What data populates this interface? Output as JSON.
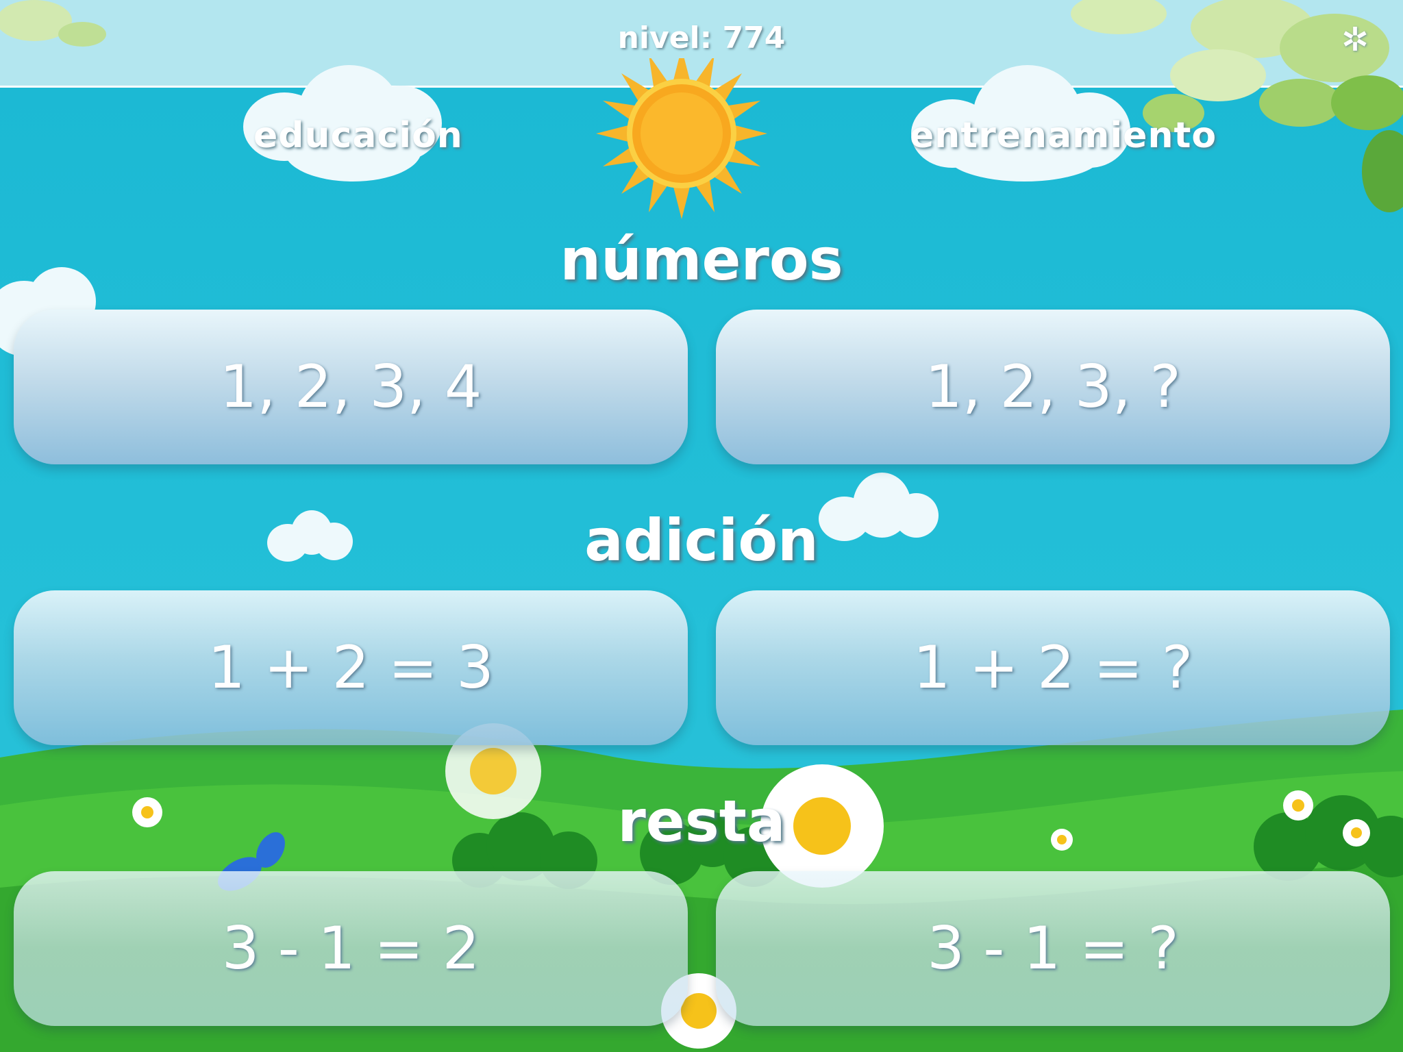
{
  "header": {
    "level_text": "nivel: 774",
    "settings_icon": "settings-icon"
  },
  "tabs": {
    "education": "educación",
    "training": "entrenamiento"
  },
  "sections": {
    "numbers": {
      "title": "números",
      "left_button": "1, 2, 3, 4",
      "right_button": "1, 2, 3, ?"
    },
    "addition": {
      "title": "adición",
      "left_button": "1 + 2 = 3",
      "right_button": "1 + 2 = ?"
    },
    "subtraction": {
      "title": "resta",
      "left_button": "3 - 1 = 2",
      "right_button": "3 - 1 = ?"
    }
  }
}
